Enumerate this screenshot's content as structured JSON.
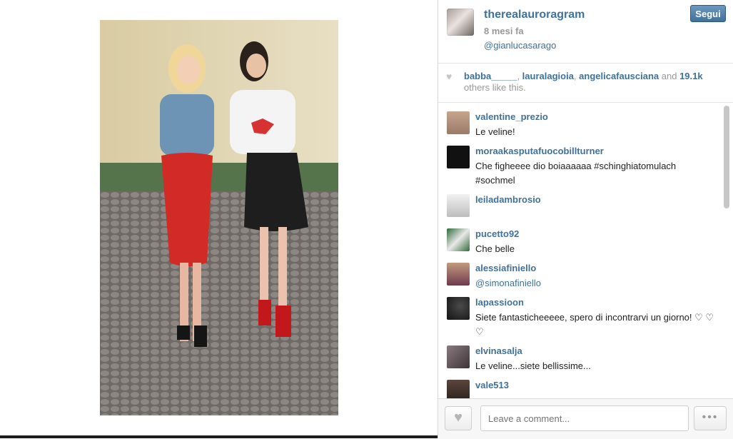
{
  "post": {
    "username": "therealauroragram",
    "time_ago": "8 mesi fa",
    "caption": "@gianlucasarago ",
    "follow_label": "Segui",
    "photo_alt_name": "two women walking on cobblestones"
  },
  "likes": {
    "users": [
      "babba_____",
      "lauralagioia",
      "angelicafausciana"
    ],
    "separator": ", ",
    "and_text": " and ",
    "count": "19.1k",
    "suffix": "others like this."
  },
  "comments": [
    {
      "user": "valentine_prezio",
      "text": "Le veline!",
      "link": false,
      "avatar_color": "#b79b86"
    },
    {
      "user": "moraakasputafuocobillturner",
      "text": "Che figheeee dio boiaaaaaa #schinghiatomulach #sochmel",
      "link": false,
      "avatar_color": "#111111"
    },
    {
      "user": "leiladambrosio",
      "text": "",
      "link": false,
      "avatar_color": "#d6d6d6"
    },
    {
      "user": "pucetto92",
      "text": "Che belle ",
      "link": false,
      "avatar_color": "#2f6b3a"
    },
    {
      "user": "alessiafiniello",
      "text": "@simonafiniello",
      "link": true,
      "avatar_color": "#7a4a5c"
    },
    {
      "user": "lapassioon",
      "text": "Siete fantasticheeeee, spero di incontrarvi un giorno! ♡ ♡ ♡",
      "link": false,
      "avatar_color": "#262626"
    },
    {
      "user": "elvinasalja",
      "text": "Le veline...siete bellissime...",
      "link": false,
      "avatar_color": "#6a5c63"
    },
    {
      "user": "vale513",
      "text": "",
      "link": false,
      "avatar_color": "#4a3a33"
    }
  ],
  "footer": {
    "comment_placeholder": "Leave a comment...",
    "like_icon": "heart-icon",
    "more_icon": "ellipsis-icon",
    "more_label": "•••"
  },
  "colors": {
    "link": "#3f729b",
    "muted": "#999999"
  }
}
